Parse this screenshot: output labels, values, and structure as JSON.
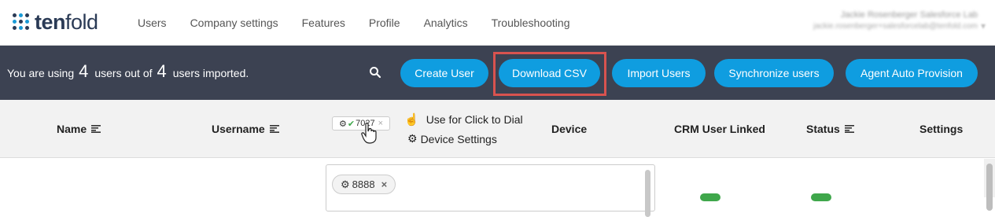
{
  "brand": {
    "logo_bold": "ten",
    "logo_light": "fold"
  },
  "nav": {
    "items": [
      {
        "label": "Users"
      },
      {
        "label": "Company settings"
      },
      {
        "label": "Features"
      },
      {
        "label": "Profile"
      },
      {
        "label": "Analytics"
      },
      {
        "label": "Troubleshooting"
      }
    ]
  },
  "user": {
    "name": "Jackie Rosenberger Salesforce Lab",
    "email": "jackie.rosenberger+salesforcelab@tenfold.com"
  },
  "usage": {
    "prefix": "You are using",
    "used": "4",
    "middle": "users out of",
    "total": "4",
    "suffix": "users imported."
  },
  "toolbar": {
    "create_user": "Create User",
    "download_csv": "Download CSV",
    "import_users": "Import Users",
    "synchronize_users": "Synchronize users",
    "agent_auto_provision": "Agent Auto Provision"
  },
  "columns": {
    "name": "Name",
    "username": "Username",
    "device": "Device",
    "crm_user_linked": "CRM User Linked",
    "status": "Status",
    "settings": "Settings"
  },
  "legend": {
    "example_chip": "7027",
    "click_to_dial": "Use for Click to Dial",
    "device_settings": "Device Settings"
  },
  "row": {
    "device_chip": "8888"
  },
  "colors": {
    "toolbar_bg": "#3c4252",
    "button_blue": "#0f9de0",
    "highlight_red": "#d9534f",
    "header_bg": "#f2f2f2",
    "toggle_green": "#3fa74b"
  }
}
